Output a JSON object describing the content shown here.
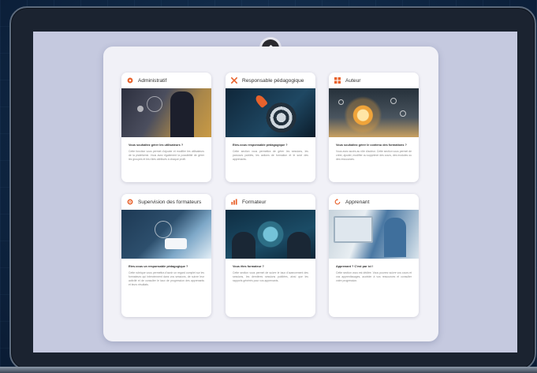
{
  "home": {
    "icon": "home-icon"
  },
  "cards": [
    {
      "title": "Administratif",
      "icon": "admin-icon",
      "icon_color": "#e8622c",
      "question": "Vous souhaitez gérer les utilisateurs ?",
      "text": "Cette fonction vous permet d'ajouter et modifier les utilisateurs de la plateforme. Vous avez également la possibilité de gérer les groupes et les rôles attribués à chaque profil."
    },
    {
      "title": "Responsable pédagogique",
      "icon": "tools-icon",
      "icon_color": "#e8622c",
      "question": "Etes-vous responsable pédagogique ?",
      "text": "Cette section vous permettra de gérer les sessions, les parcours publiés, les actions de formation et le suivi des apprenants."
    },
    {
      "title": "Auteur",
      "icon": "grid-icon",
      "icon_color": "#e8622c",
      "question": "Vous souhaitez gérer le contenu des formations ?",
      "text": "Vous avez accès au rôle d'auteur. Cette section vous permet de créer, ajouter, modifier ou supprimer des cours, des modules ou des ressources."
    },
    {
      "title": "Supervision des formateurs",
      "icon": "target-icon",
      "icon_color": "#e8622c",
      "question": "Etes-vous un responsable pédagogique ?",
      "text": "Cette rubrique vous permettra d'avoir un regard complet sur les formateurs qui interviennent dans vos sessions, de suivre leur activité et de consulter le taux de progression des apprenants et leurs résultats."
    },
    {
      "title": "Formateur",
      "icon": "chart-icon",
      "icon_color": "#e8622c",
      "question": "Vous êtes formateur ?",
      "text": "Cette section vous permet de suivre le taux d'avancement des sessions, les dernières sessions publiées, ainsi que les rapports générés pour vos apprenants."
    },
    {
      "title": "Apprenant",
      "icon": "refresh-icon",
      "icon_color": "#e8622c",
      "question": "Apprenant ? C'est par ici !",
      "text": "Cette section vous est dédiée. Vous pourrez suivre vos cours et vos apprentissages, accéder à vos ressources et consulter votre progression."
    }
  ]
}
